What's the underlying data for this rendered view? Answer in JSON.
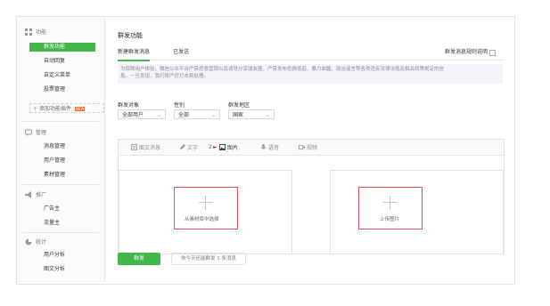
{
  "sidebar": {
    "sections": [
      {
        "title": "功能",
        "icon": "grid-icon",
        "items": [
          "群发功能",
          "自动回复",
          "自定义菜单",
          "投票管理"
        ]
      },
      {
        "title": "管理",
        "icon": "chat-icon",
        "items": [
          "消息管理",
          "用户管理",
          "素材管理"
        ]
      },
      {
        "title": "推广",
        "icon": "megaphone-icon",
        "items": [
          "广告主",
          "流量主"
        ]
      },
      {
        "title": "统计",
        "icon": "pie-chart-icon",
        "items": [
          "用户分析",
          "图文分析"
        ]
      }
    ],
    "add_plugin_label": "添加功能插件",
    "add_plugin_badge": "NEW",
    "active_item": "群发功能"
  },
  "main": {
    "title": "群发功能",
    "tabs": [
      "新建群发消息",
      "已发送"
    ],
    "active_tab": "新建群发消息",
    "rules_label": "群发消息规则说明",
    "notice_line1": "为保障用户体验，微信公众平台严禁恶意营销以及诱导分享朋友圈，严禁发布色情低俗、暴力血腥、政治谣言等各类违反法律法规及相关政策规定的信",
    "notice_line2": "息。一旦发现，我们将严厉打击和处理。",
    "filters": [
      {
        "label": "群发对象",
        "value": "全部用户"
      },
      {
        "label": "性别",
        "value": "全部"
      },
      {
        "label": "群发地区",
        "value": "国家"
      }
    ],
    "tools": [
      {
        "label": "图文消息",
        "icon": "article-icon"
      },
      {
        "label": "文字",
        "icon": "pen-icon"
      },
      {
        "label": "图片",
        "icon": "image-icon"
      },
      {
        "label": "语音",
        "icon": "microphone-icon"
      },
      {
        "label": "视频",
        "icon": "video-icon"
      }
    ],
    "active_tool": "图片",
    "step_marker": "2",
    "library_label": "从素材库中选择",
    "upload_label": "上传图片",
    "send_button": "群发",
    "quota_text": "你今天还能群发 1 条消息"
  },
  "colors": {
    "accent": "#44b549",
    "highlight_box": "#e05050",
    "badge": "#f26a2a"
  }
}
